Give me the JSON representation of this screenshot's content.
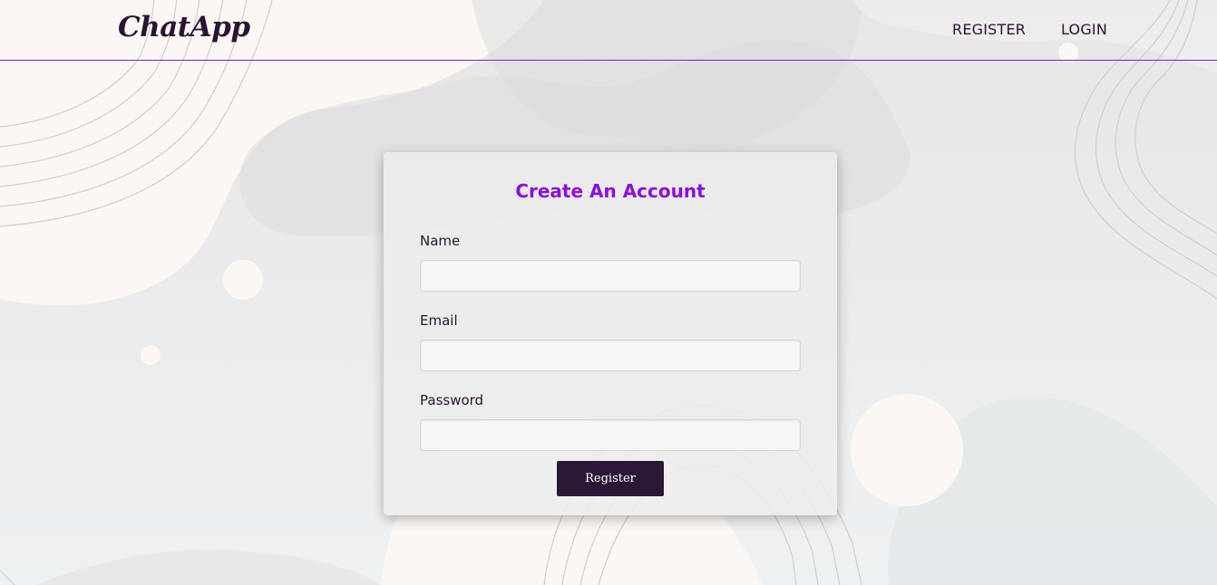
{
  "app": {
    "brand": "ChatApp"
  },
  "nav": {
    "register_label": "REGISTER",
    "login_label": "LOGIN"
  },
  "form": {
    "title": "Create An Account",
    "name_label": "Name",
    "name_value": "",
    "email_label": "Email",
    "email_value": "",
    "password_label": "Password",
    "password_value": "",
    "submit_label": "Register"
  },
  "colors": {
    "accent": "#8a0ee0",
    "nav_border": "#7e1fd1",
    "text_dark": "#2b1433",
    "button_bg": "#2b1836"
  }
}
